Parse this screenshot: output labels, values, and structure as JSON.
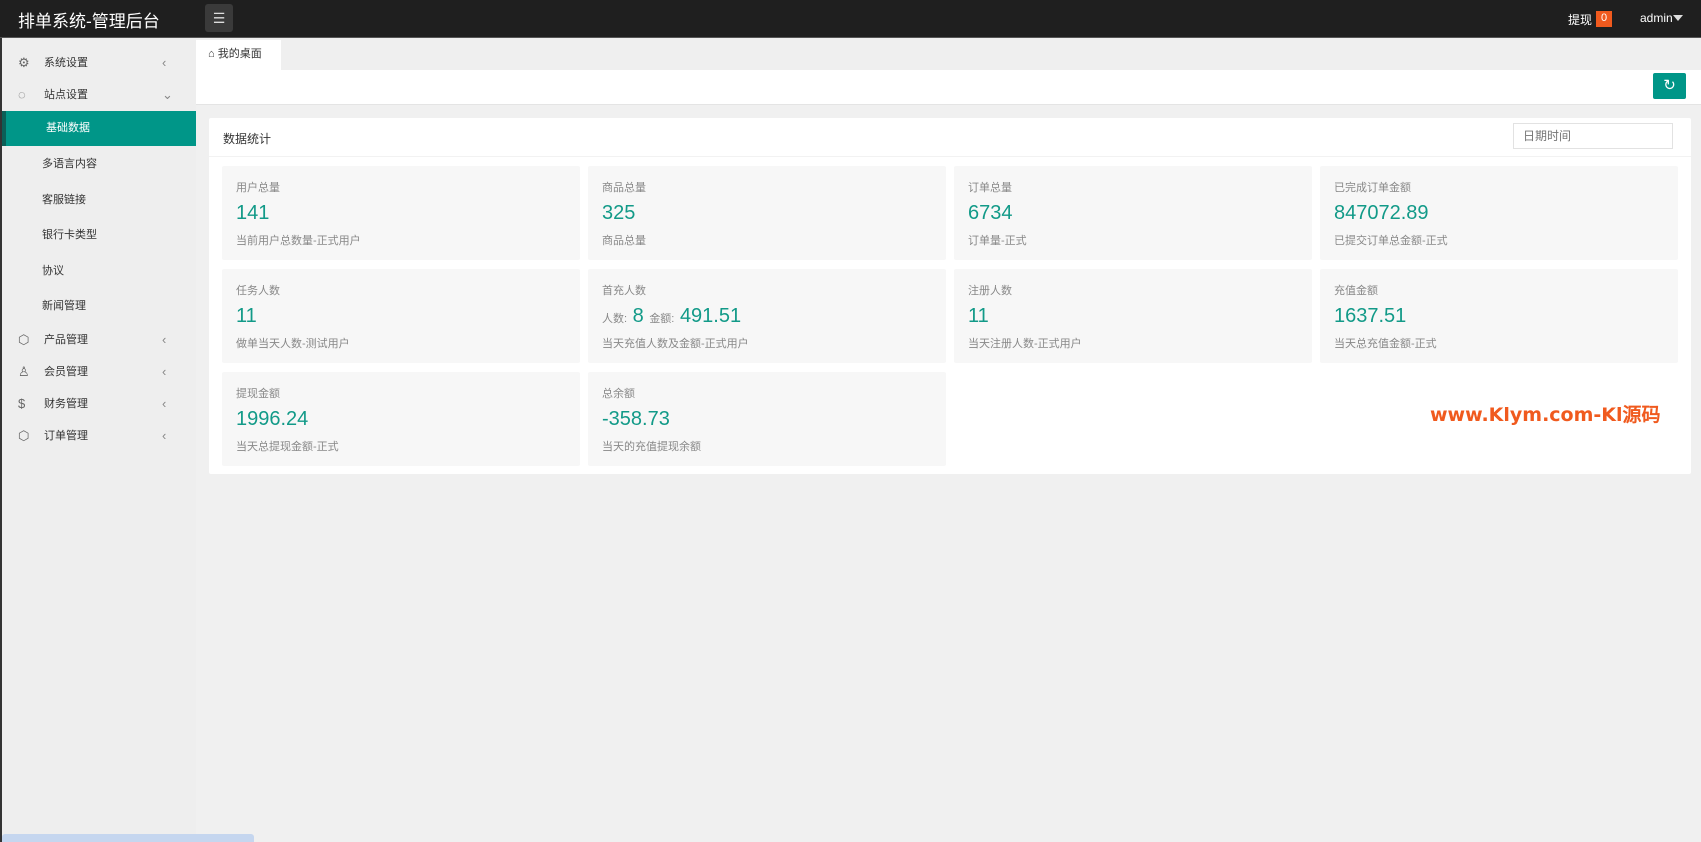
{
  "header": {
    "title": "排单系统-管理后台",
    "withdraw_label": "提现",
    "withdraw_count": "0",
    "user": "admin"
  },
  "sidebar": {
    "items": [
      {
        "label": "系统设置"
      },
      {
        "label": "站点设置"
      },
      {
        "label": "产品管理"
      },
      {
        "label": "会员管理"
      },
      {
        "label": "财务管理"
      },
      {
        "label": "订单管理"
      }
    ],
    "sub_items": [
      {
        "label": "基础数据"
      },
      {
        "label": "多语言内容"
      },
      {
        "label": "客服链接"
      },
      {
        "label": "银行卡类型"
      },
      {
        "label": "协议"
      },
      {
        "label": "新闻管理"
      }
    ]
  },
  "tabs": [
    {
      "label": "我的桌面"
    }
  ],
  "panel": {
    "title": "数据统计",
    "date_placeholder": "日期时间"
  },
  "cards": [
    {
      "title": "用户总量",
      "value": "141",
      "desc": "当前用户总数量-正式用户"
    },
    {
      "title": "商品总量",
      "value": "325",
      "desc": "商品总量"
    },
    {
      "title": "订单总量",
      "value": "6734",
      "desc": "订单量-正式"
    },
    {
      "title": "已完成订单金额",
      "value": "847072.89",
      "desc": "已提交订单总金额-正式"
    },
    {
      "title": "任务人数",
      "value": "11",
      "desc": "做单当天人数-测试用户"
    },
    {
      "title": "首充人数",
      "count_label": "人数:",
      "value": "8",
      "amount_label": "金额:",
      "amount": "491.51",
      "desc": "当天充值人数及金额-正式用户"
    },
    {
      "title": "注册人数",
      "value": "11",
      "desc": "当天注册人数-正式用户"
    },
    {
      "title": "充值金额",
      "value": "1637.51",
      "desc": "当天总充值金额-正式"
    },
    {
      "title": "提现金额",
      "value": "1996.24",
      "desc": "当天总提现金额-正式"
    },
    {
      "title": "总余额",
      "value": "-358.73",
      "desc": "当天的充值提现余额"
    }
  ],
  "watermark": "www.Klym.com-Kl源码"
}
